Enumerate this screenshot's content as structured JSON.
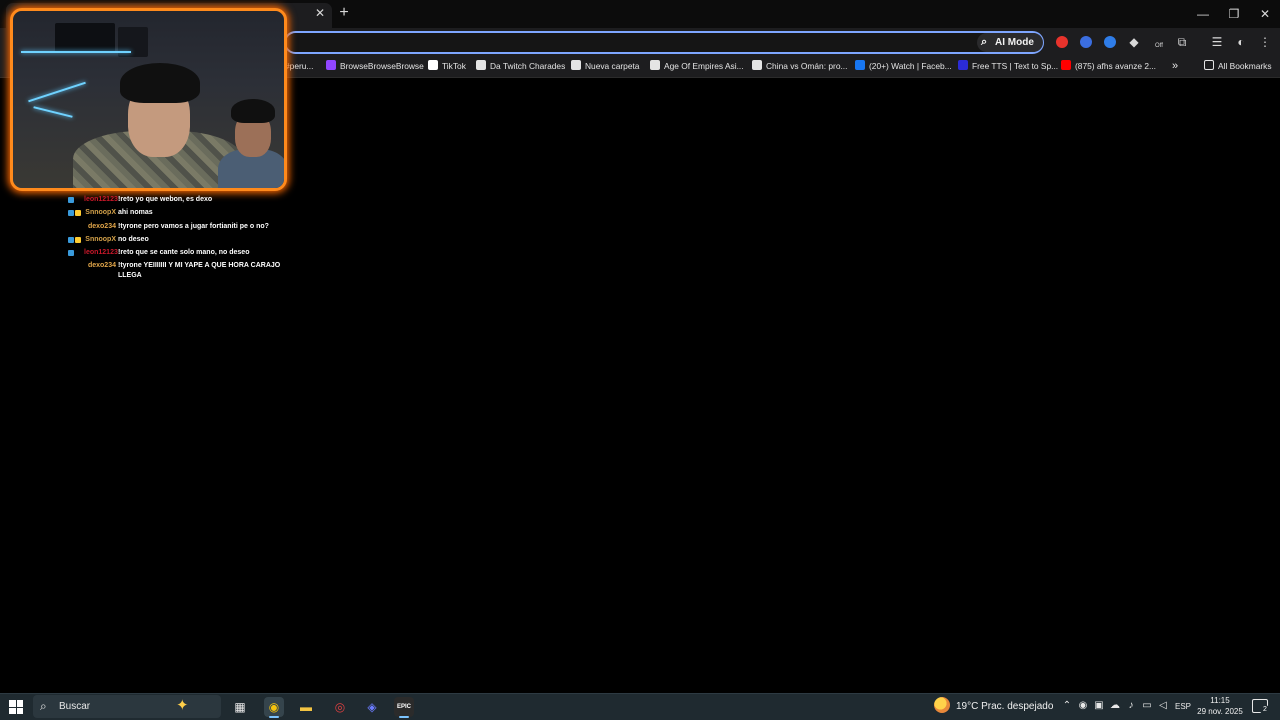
{
  "browser": {
    "tab_close": "✕",
    "new_tab": "+",
    "window_controls": [
      "—",
      "❐",
      "✕"
    ],
    "ai_mode_label": "AI Mode",
    "ext_off_badge": "Off",
    "extension_colors": [
      "#e8332c",
      "#3b6ee0",
      "#2f7de8"
    ],
    "bookmarks": [
      {
        "label": "#peru...",
        "icon": "bookmark-icon",
        "color": "#9b59b6"
      },
      {
        "label": "BrowseBrowseBrowse",
        "icon": "twitch-icon",
        "color": "#9146ff"
      },
      {
        "label": "TikTok",
        "icon": "tiktok-icon",
        "color": "#ffffff"
      },
      {
        "label": "Da Twitch Charades",
        "icon": "puzzle-icon",
        "color": "#e4e4e4"
      },
      {
        "label": "Nueva carpeta",
        "icon": "folder-icon",
        "color": "#e4e4e4"
      },
      {
        "label": "Age Of Empires Asi...",
        "icon": "globe-icon",
        "color": "#e4e4e4"
      },
      {
        "label": "China vs Omán: pro...",
        "icon": "soccer-icon",
        "color": "#e4e4e4"
      },
      {
        "label": "(20+) Watch | Faceb...",
        "icon": "facebook-icon",
        "color": "#1877f2"
      },
      {
        "label": "Free TTS | Text to Sp...",
        "icon": "tts-icon",
        "color": "#2b2bd6"
      },
      {
        "label": "(875) afhs avanze 2...",
        "icon": "youtube-icon",
        "color": "#ff0000"
      }
    ],
    "bookmarks_overflow": "»",
    "all_bookmarks": "All Bookmarks"
  },
  "chat": {
    "messages": [
      {
        "user": "leon12123",
        "user_color": "#c8182a",
        "badges": [
          "#3a9bdc"
        ],
        "text": "!reto yo que webon, es dexo"
      },
      {
        "user": "SnnoopX",
        "user_color": "#d4a24a",
        "badges": [
          "#3a9bdc",
          "#ffcc33"
        ],
        "text": "ahi nomas"
      },
      {
        "user": "dexo234",
        "user_color": "#e2a64a",
        "badges": [],
        "text": "!tyrone pero vamos a jugar fortianiti pe o no?"
      },
      {
        "user": "SnnoopX",
        "user_color": "#d4a24a",
        "badges": [
          "#3a9bdc",
          "#ffcc33"
        ],
        "text": "no deseo"
      },
      {
        "user": "leon12123",
        "user_color": "#c8182a",
        "badges": [
          "#3a9bdc"
        ],
        "text": "!reto que se cante solo mano, no deseo"
      },
      {
        "user": "dexo234",
        "user_color": "#e2a64a",
        "badges": [],
        "text": "!tyrone YEIIIIIII Y MI YAPE A QUE HORA CARAJO LLEGA"
      }
    ]
  },
  "taskbar": {
    "search_placeholder": "Buscar",
    "apps": [
      {
        "icon": "task-view-icon",
        "glyph": "▦",
        "color": "#e8e8e8"
      },
      {
        "icon": "chrome-icon",
        "glyph": "◉",
        "color": "#f4c20d"
      },
      {
        "icon": "file-explorer-icon",
        "glyph": "▬",
        "color": "#f3c442"
      },
      {
        "icon": "obs-icon",
        "glyph": "◎",
        "color": "#e04040"
      },
      {
        "icon": "discord-icon",
        "glyph": "◈",
        "color": "#6b7cff"
      },
      {
        "icon": "epic-games-icon",
        "glyph": "EPIC",
        "color": "#ffffff"
      }
    ],
    "weather": "19°C  Prac. despejado",
    "language": "ESP",
    "time": "11:15",
    "date": "29 nov. 2025",
    "notification_count": "2"
  }
}
